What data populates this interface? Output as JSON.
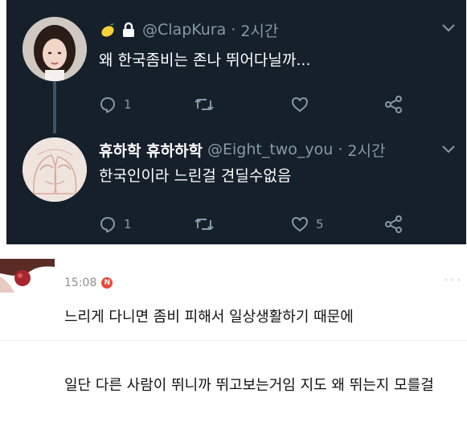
{
  "tweet1": {
    "icons": [
      "lemon-emoji",
      "lock-icon"
    ],
    "handle": "@ClapKura",
    "time": "2시간",
    "text": "왜 한국좀비는 존나 뛰어다닐까...",
    "reply_count": "1",
    "retweet_count": "",
    "like_count": ""
  },
  "tweet2": {
    "display_name": "휴하학 휴하하학",
    "handle": "@Eight_two_you",
    "time": "2시간",
    "text": "한국인이라 느린걸 견딜수없음",
    "reply_count": "1",
    "retweet_count": "",
    "like_count": "5"
  },
  "separator": "·",
  "comments": [
    {
      "time": "15:08",
      "badge": "N",
      "text": "느리게 다니면 좀비 피해서 일상생활하기 때문에"
    },
    {
      "text": "일단 다른 사람이 뛰니까 뛰고보는거임 지도 왜 뛰는지 모를걸"
    }
  ],
  "colors": {
    "dark_bg": "#15202b",
    "muted": "#8899a6",
    "thread_line": "#3d5466",
    "badge": "#e8473c"
  }
}
